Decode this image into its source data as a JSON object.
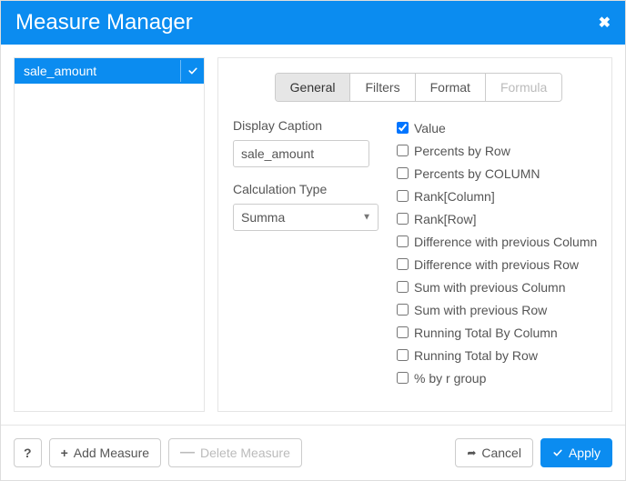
{
  "title": "Measure Manager",
  "sidebar": {
    "items": [
      {
        "label": "sale_amount",
        "selected": true
      }
    ]
  },
  "tabs": [
    {
      "label": "General",
      "state": "active"
    },
    {
      "label": "Filters",
      "state": "normal"
    },
    {
      "label": "Format",
      "state": "normal"
    },
    {
      "label": "Formula",
      "state": "disabled"
    }
  ],
  "general": {
    "display_caption_label": "Display Caption",
    "display_caption_value": "sale_amount",
    "calc_type_label": "Calculation Type",
    "calc_type_value": "Summa",
    "functions": [
      {
        "label": "Value",
        "checked": true
      },
      {
        "label": "Percents by Row",
        "checked": false
      },
      {
        "label": "Percents by COLUMN",
        "checked": false
      },
      {
        "label": "Rank[Column]",
        "checked": false
      },
      {
        "label": "Rank[Row]",
        "checked": false
      },
      {
        "label": "Difference with previous Column",
        "checked": false
      },
      {
        "label": "Difference with previous Row",
        "checked": false
      },
      {
        "label": "Sum with previous Column",
        "checked": false
      },
      {
        "label": "Sum with previous Row",
        "checked": false
      },
      {
        "label": "Running Total By Column",
        "checked": false
      },
      {
        "label": "Running Total by Row",
        "checked": false
      },
      {
        "label": "% by r group",
        "checked": false
      }
    ]
  },
  "footer": {
    "help": "?",
    "add": "Add Measure",
    "delete": "Delete Measure",
    "cancel": "Cancel",
    "apply": "Apply"
  }
}
